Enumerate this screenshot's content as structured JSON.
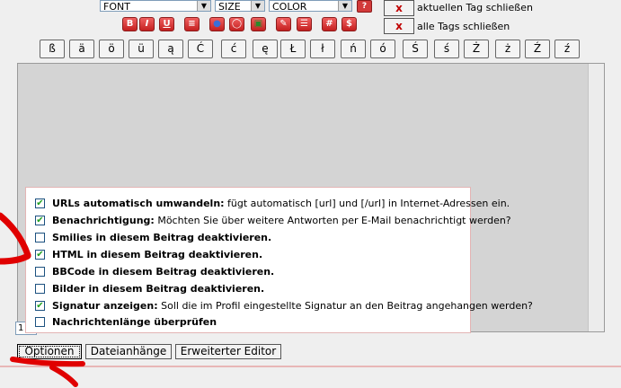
{
  "toolbar": {
    "font_select": "FONT",
    "size_select": "SIZE",
    "color_select": "COLOR",
    "help_label": "?",
    "close_current_x": "x",
    "close_current_label": "aktuellen Tag schließen",
    "close_all_x": "x",
    "close_all_label": "alle Tags schließen",
    "format_buttons": [
      {
        "label": "B",
        "icon": "bold-icon"
      },
      {
        "label": "I",
        "icon": "italic-icon"
      },
      {
        "label": "U",
        "icon": "underline-icon"
      },
      {
        "label": "≡",
        "icon": "align-icon"
      },
      {
        "label": "●",
        "icon": "url-icon"
      },
      {
        "label": "◯",
        "icon": "email-icon"
      },
      {
        "label": "▣",
        "icon": "image-icon"
      },
      {
        "label": "✎",
        "icon": "quote-icon"
      },
      {
        "label": "☰",
        "icon": "list-icon"
      },
      {
        "label": "#",
        "icon": "hash-icon"
      },
      {
        "label": "$",
        "icon": "code-icon"
      }
    ]
  },
  "special_chars": [
    "ß",
    "ä",
    "ö",
    "ü",
    "ą",
    "Ć",
    "ć",
    "ę",
    "Ł",
    "ł",
    "ń",
    "ó",
    "Ś",
    "ś",
    "Ż",
    "ż",
    "Ź",
    "ź"
  ],
  "options": [
    {
      "checked": true,
      "label": "URLs automatisch umwandeln:",
      "desc": " fügt automatisch [url] und [/url] in Internet-Adressen ein."
    },
    {
      "checked": true,
      "label": "Benachrichtigung:",
      "desc": " Möchten Sie über weitere Antworten per E-Mail benachrichtigt werden?"
    },
    {
      "checked": false,
      "label": "Smilies in diesem Beitrag deaktivieren.",
      "desc": ""
    },
    {
      "checked": true,
      "label": "HTML in diesem Beitrag deaktivieren.",
      "desc": ""
    },
    {
      "checked": false,
      "label": "BBCode in diesem Beitrag deaktivieren.",
      "desc": ""
    },
    {
      "checked": false,
      "label": "Bilder in diesem Beitrag deaktivieren.",
      "desc": ""
    },
    {
      "checked": true,
      "label": "Signatur anzeigen:",
      "desc": " Soll die im Profil eingestellte Signatur an den Beitrag angehangen werden?"
    },
    {
      "checked": false,
      "label": "Nachrichtenlänge überprüfen",
      "desc": ""
    }
  ],
  "bottom_buttons": {
    "optionen": "Optionen",
    "dateianhaenge": "Dateianhänge",
    "erweiterter_editor": "Erweiterter Editor"
  },
  "field_fragment": "1",
  "accent_colors": {
    "annotation_red": "#e00000",
    "button_red": "#d23a3a"
  }
}
